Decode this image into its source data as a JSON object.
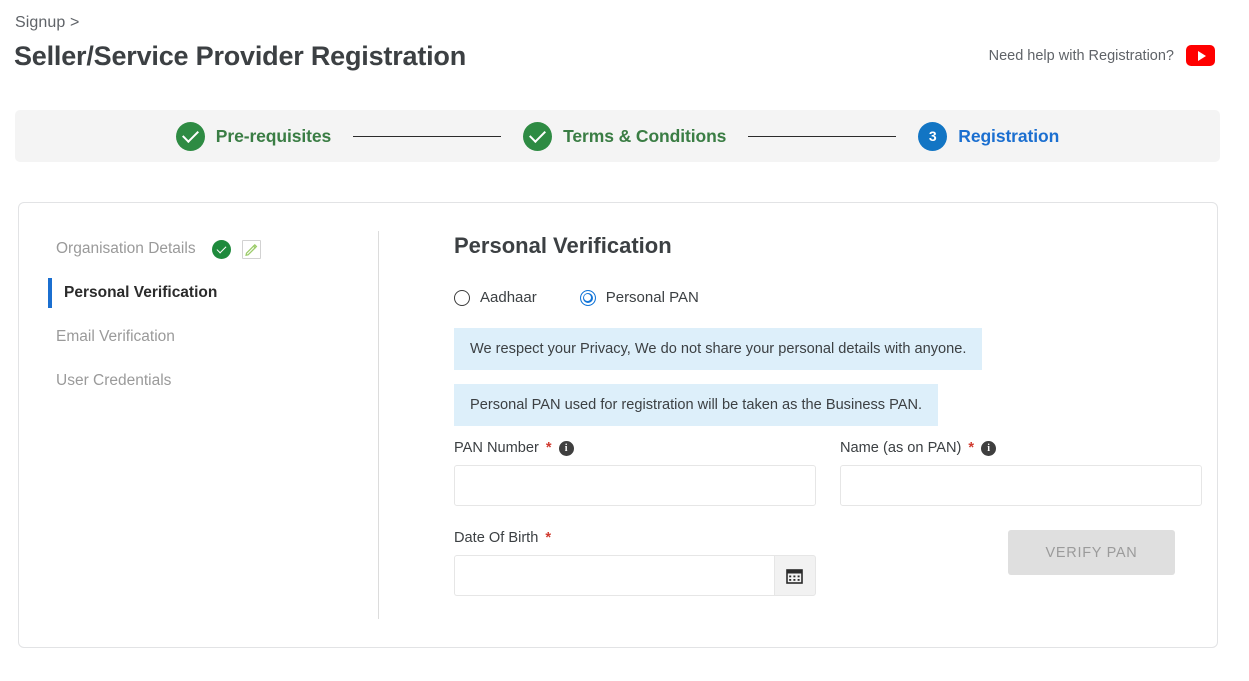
{
  "header": {
    "breadcrumb": "Signup >",
    "title": "Seller/Service Provider Registration",
    "help_text": "Need help with Registration?",
    "help_icon": "youtube-icon"
  },
  "stepper": {
    "steps": [
      {
        "label": "Pre-requisites",
        "state": "done",
        "badge": "check"
      },
      {
        "label": "Terms & Conditions",
        "state": "done",
        "badge": "check"
      },
      {
        "label": "Registration",
        "state": "active",
        "badge": "3"
      }
    ]
  },
  "sidebar": {
    "items": [
      {
        "label": "Organisation Details",
        "state": "completed",
        "icons": [
          "green-check-icon",
          "edit-pencil-icon"
        ]
      },
      {
        "label": "Personal Verification",
        "state": "active",
        "icons": []
      },
      {
        "label": "Email Verification",
        "state": "pending",
        "icons": []
      },
      {
        "label": "User Credentials",
        "state": "pending",
        "icons": []
      }
    ]
  },
  "form": {
    "title": "Personal Verification",
    "radios": [
      {
        "label": "Aadhaar",
        "checked": false
      },
      {
        "label": "Personal PAN",
        "checked": true
      }
    ],
    "banners": [
      "We respect your Privacy, We do not share your personal details with anyone.",
      "Personal PAN used for registration will be taken as the Business PAN."
    ],
    "fields": {
      "pan_number": {
        "label": "PAN Number",
        "required": "*",
        "value": "",
        "placeholder": "",
        "info": "i"
      },
      "name_as_on_pan": {
        "label": "Name (as on PAN)",
        "required": "*",
        "value": "",
        "placeholder": "",
        "info": "i"
      },
      "date_of_birth": {
        "label": "Date Of Birth",
        "required": "*",
        "value": "",
        "placeholder": "",
        "calendar_icon": "calendar-icon"
      }
    },
    "verify_button": {
      "label": "VERIFY PAN",
      "disabled": true
    }
  },
  "colors": {
    "accent_blue": "#1275d8",
    "step_done_green": "#2e8b43",
    "banner_blue": "#ddeffa",
    "youtube_red": "#ff0000",
    "required_red": "#d03a2f"
  }
}
